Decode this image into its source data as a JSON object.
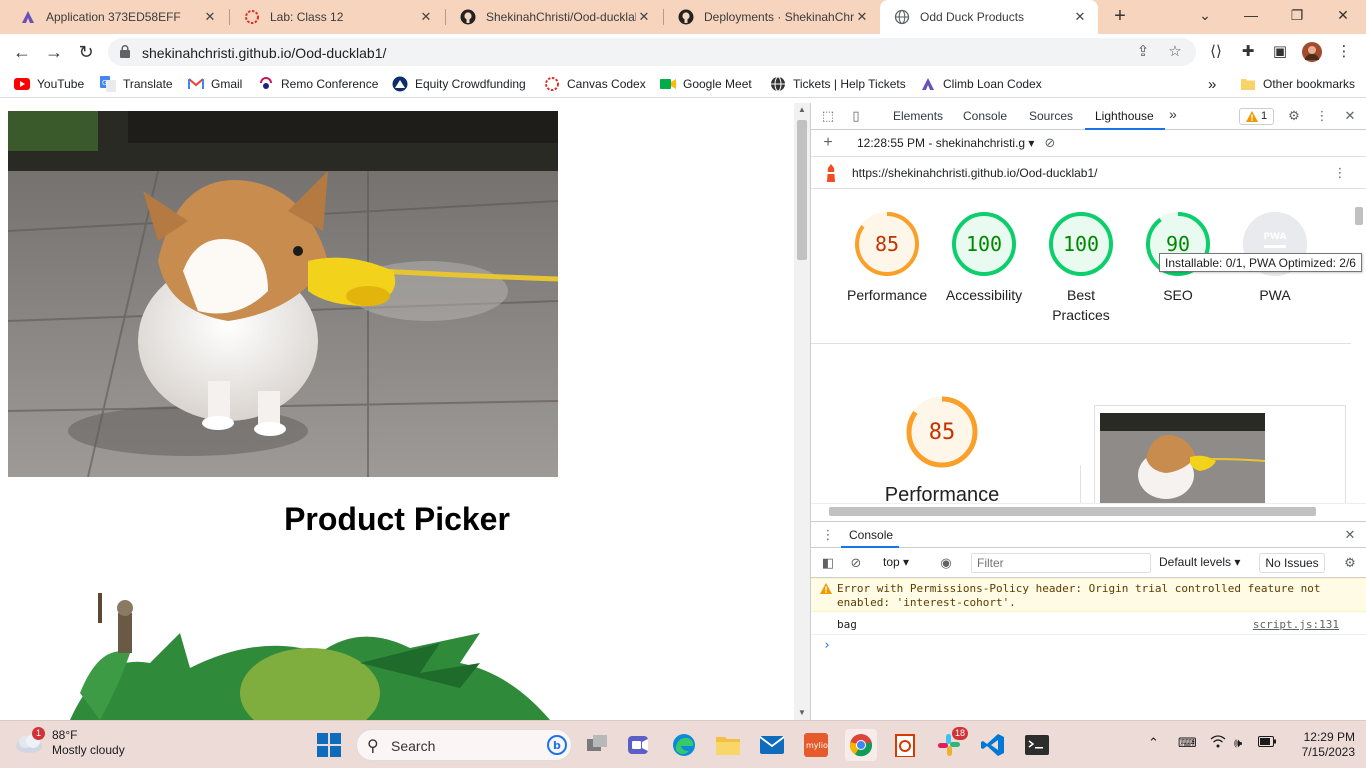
{
  "browser": {
    "tabs": [
      {
        "label": "Application 373ED58EFF",
        "icon": "canvas-logo-icon"
      },
      {
        "label": "Lab: Class 12",
        "icon": "canvas-ring-icon"
      },
      {
        "label": "ShekinahChristi/Ood-ducklab",
        "icon": "github-icon"
      },
      {
        "label": "Deployments · ShekinahChris",
        "icon": "github-icon"
      },
      {
        "label": "Odd Duck Products",
        "icon": "globe-icon"
      }
    ],
    "url": "shekinahchristi.github.io/Ood-ducklab1/",
    "bookmarks": [
      {
        "label": "YouTube"
      },
      {
        "label": "Translate"
      },
      {
        "label": "Gmail"
      },
      {
        "label": "Remo Conference"
      },
      {
        "label": "Equity Crowdfunding"
      },
      {
        "label": "Canvas Codex"
      },
      {
        "label": "Google Meet"
      },
      {
        "label": "Tickets | Help Tickets"
      },
      {
        "label": "Climb Loan Codex"
      }
    ],
    "more_bookmarks": "»",
    "other_bookmarks": "Other bookmarks"
  },
  "page": {
    "title": "Product Picker"
  },
  "devtools": {
    "tabs": [
      "Elements",
      "Console",
      "Sources",
      "Lighthouse"
    ],
    "more_tabs": "»",
    "warning_count": "1",
    "report_time": "12:28:55 PM - shekinahchristi.g",
    "report_url": "https://shekinahchristi.github.io/Ood-ducklab1/",
    "scores": [
      {
        "value": "85",
        "label": "Performance",
        "score": 0.85,
        "color": "#fa9f28",
        "fill": "#fff6ea",
        "text_color": "#c33300"
      },
      {
        "value": "100",
        "label": "Accessibility",
        "score": 1.0,
        "color": "#0cce6b",
        "fill": "#e9fbf1",
        "text_color": "#008800"
      },
      {
        "value": "100",
        "label": "Best Practices",
        "score": 1.0,
        "color": "#0cce6b",
        "fill": "#e9fbf1",
        "text_color": "#008800"
      },
      {
        "value": "90",
        "label": "SEO",
        "score": 0.9,
        "color": "#0cce6b",
        "fill": "#e9fbf1",
        "text_color": "#008800"
      },
      {
        "value": "PWA",
        "label": "PWA",
        "score": 0,
        "color": "#dadce0",
        "fill": "#e8eaed",
        "text_color": "#9aa0a6"
      }
    ],
    "tooltip": "Installable: 0/1, PWA Optimized: 2/6",
    "big_score": {
      "value": "85",
      "label": "Performance"
    },
    "console": {
      "title": "Console",
      "context": "top",
      "filter_placeholder": "Filter",
      "levels": "Default levels",
      "issues": "No Issues",
      "warning": "Error with Permissions-Policy header: Origin trial controlled feature not enabled: 'interest-cohort'.",
      "log_text": "bag",
      "log_source": "script.js:131",
      "prompt": "›"
    }
  },
  "taskbar": {
    "weather_temp": "88°F",
    "weather_desc": "Mostly cloudy",
    "weather_badge": "1",
    "search_label": "Search",
    "slack_badge": "18",
    "time": "12:29 PM",
    "date": "7/15/2023"
  }
}
